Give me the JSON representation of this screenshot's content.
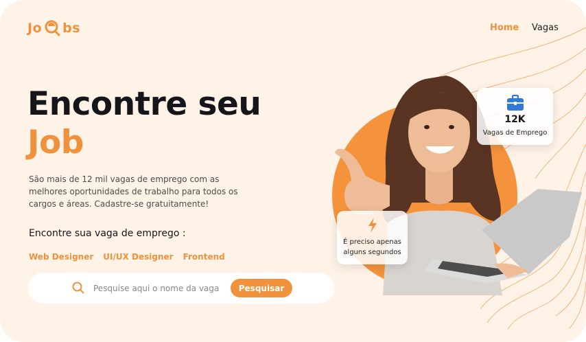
{
  "brand": {
    "logo_left": "Jo",
    "logo_right": "bs",
    "accent_color": "#f0923b",
    "background_color": "#fff3e8"
  },
  "nav": {
    "items": [
      {
        "label": "Home",
        "active": true
      },
      {
        "label": "Vagas",
        "active": false
      }
    ]
  },
  "hero": {
    "title_line1": "Encontre seu",
    "title_line2": "Job",
    "description": "São mais de 12 mil vagas de emprego com as melhores oportunidades de trabalho para todos os cargos e áreas. Cadastre-se gratuitamente!",
    "subtitle": "Encontre sua vaga de emprego :",
    "tags": [
      "Web Designer",
      "UI/UX Designer",
      "Frontend"
    ]
  },
  "search": {
    "placeholder": "Pesquise aqui o nome da vaga",
    "button_label": "Pesquisar",
    "icon": "search-icon"
  },
  "stats_card": {
    "icon": "briefcase-icon",
    "value": "12K",
    "label": "Vagas de Emprego"
  },
  "info_card": {
    "icon": "lightning-icon",
    "label": "É preciso apenas alguns segundos"
  }
}
